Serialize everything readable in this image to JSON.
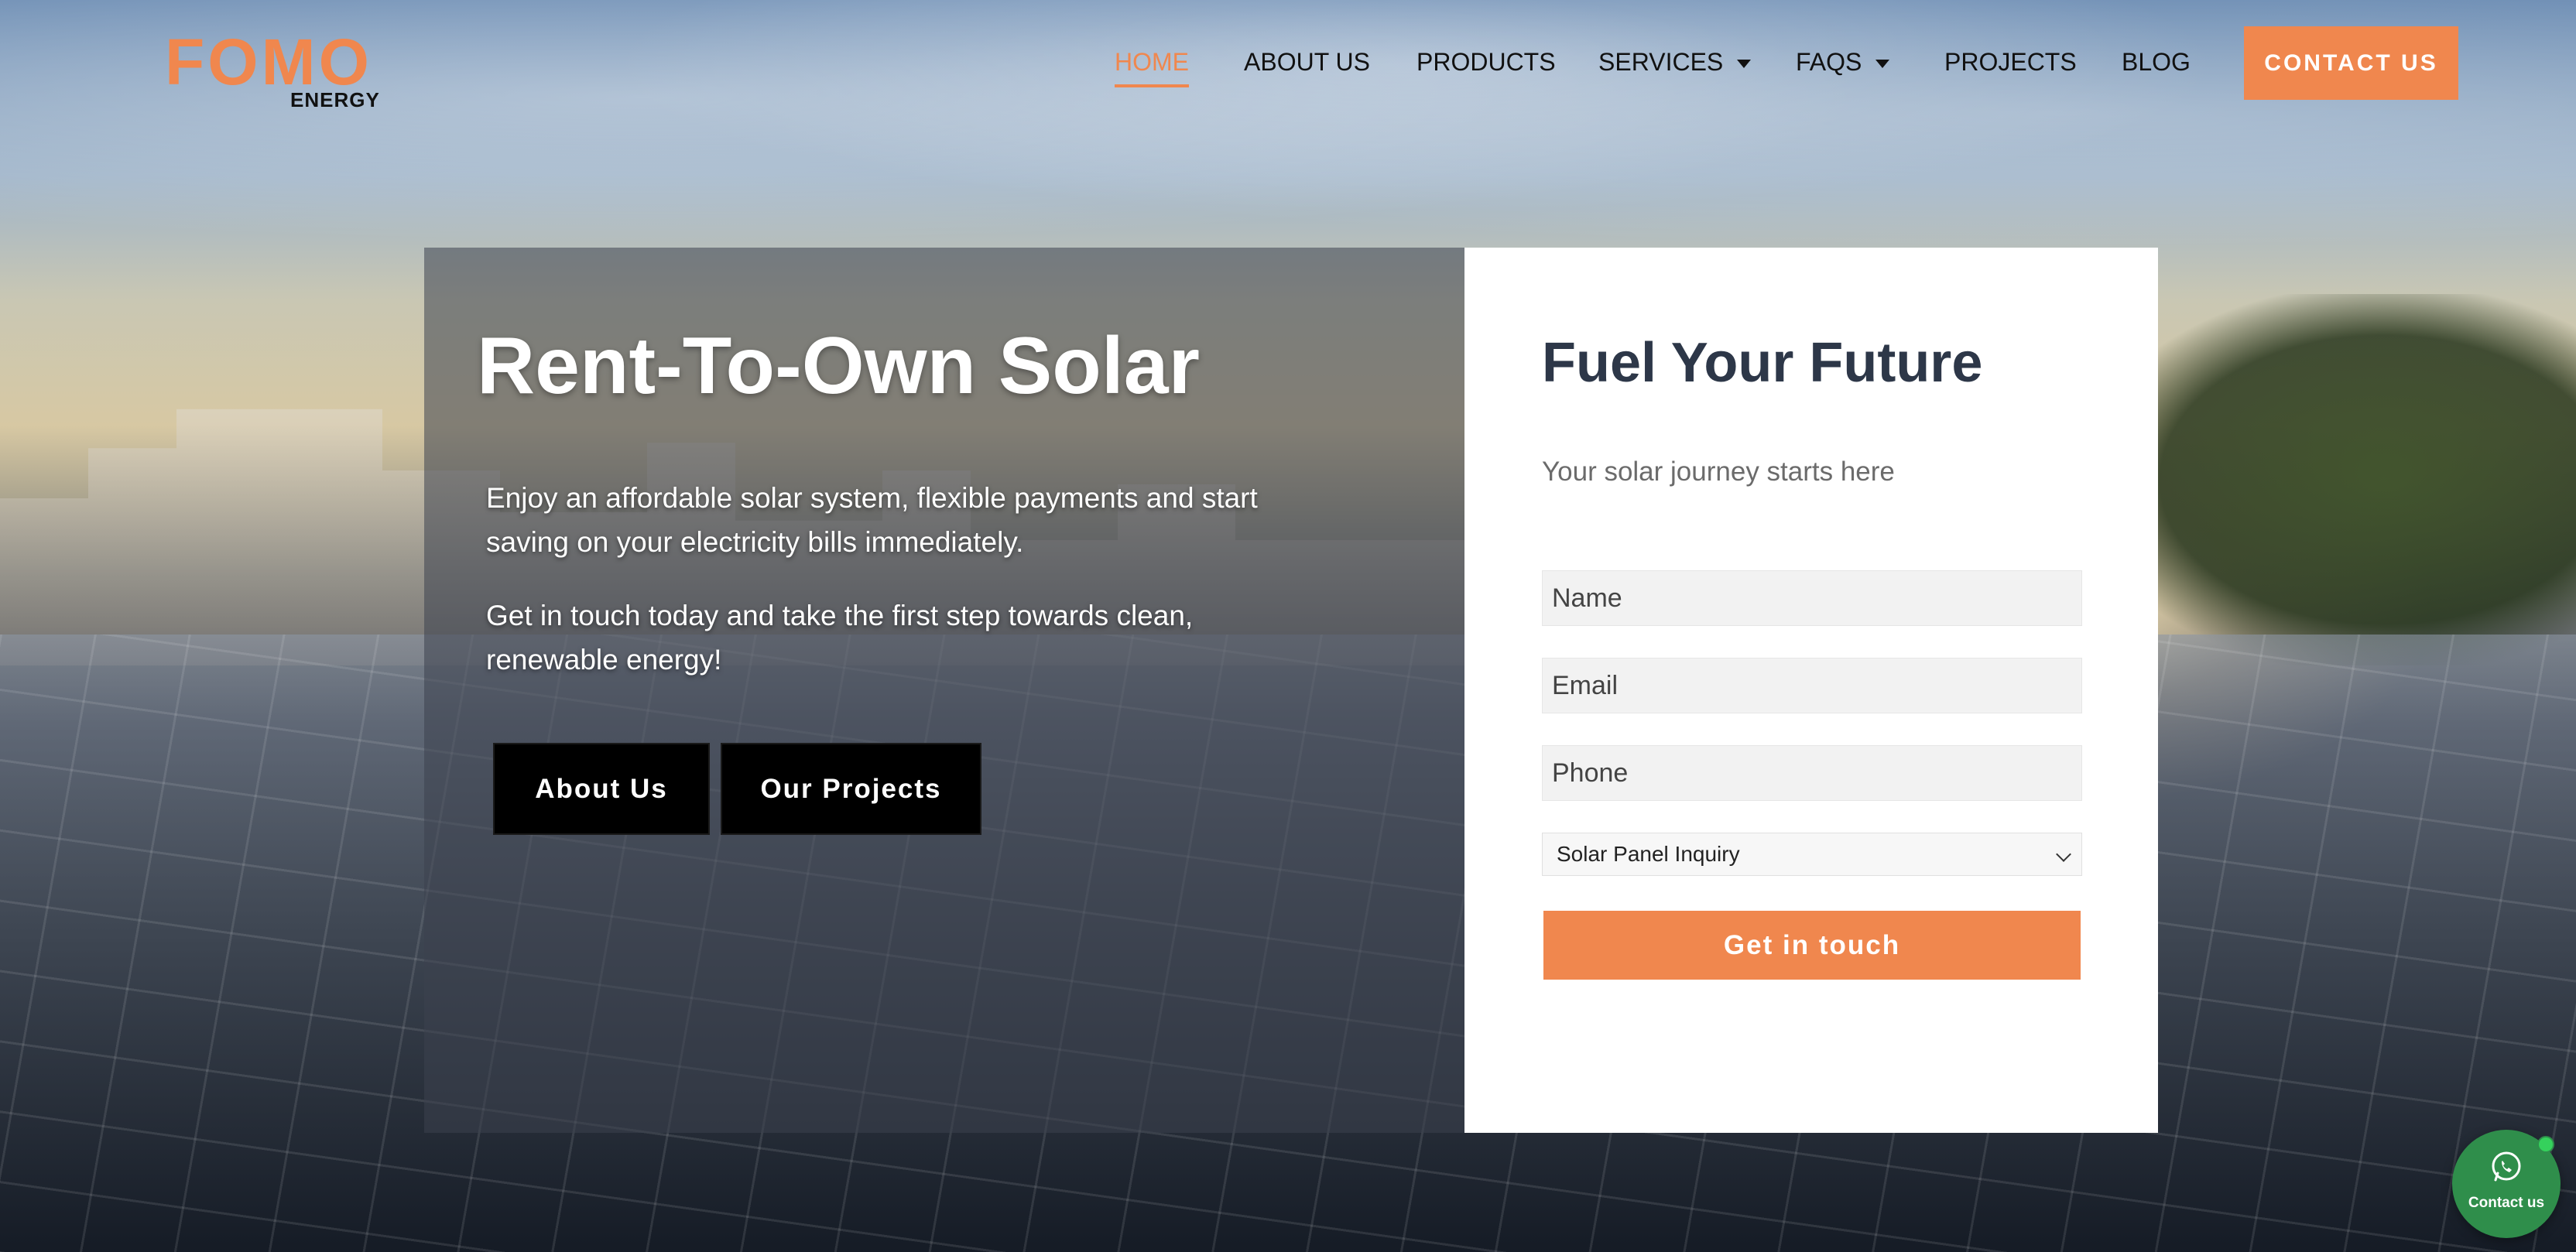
{
  "brand": {
    "name": "FOMO",
    "sub": "ENERGY"
  },
  "nav": {
    "items": [
      "HOME",
      "ABOUT US",
      "PRODUCTS",
      "SERVICES",
      "FAQS",
      "PROJECTS",
      "BLOG"
    ],
    "active": "HOME",
    "contact_label": "CONTACT US"
  },
  "hero": {
    "title": "Rent-To-Own Solar",
    "p1": "Enjoy an affordable solar system, flexible payments and start saving on your electricity bills immediately.",
    "p2": "Get in touch today and take the first step towards clean, renewable energy!",
    "btn_about": "About Us",
    "btn_projects": "Our Projects"
  },
  "form": {
    "title": "Fuel Your Future",
    "subtitle": "Your solar journey starts here",
    "name_placeholder": "Name",
    "email_placeholder": "Email",
    "phone_placeholder": "Phone",
    "select_value": "Solar Panel Inquiry",
    "submit_label": "Get in touch"
  },
  "whatsapp": {
    "label": "Contact us",
    "icon": "whatsapp-icon"
  },
  "colors": {
    "accent": "#f0874e",
    "heading": "#2d3748",
    "whatsapp": "#2f8e4b"
  }
}
